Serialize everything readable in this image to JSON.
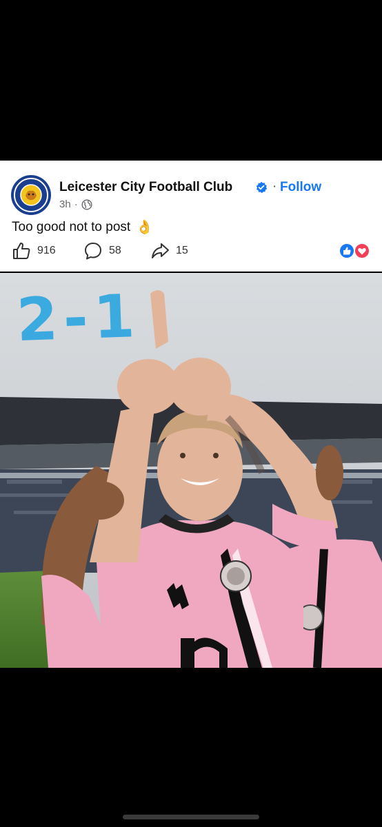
{
  "post": {
    "page_name": "Leicester City Football Club",
    "separator": "·",
    "follow_label": "Follow",
    "time": "3h",
    "meta_separator": "·",
    "caption": "Too good not to post",
    "caption_emoji": "👌",
    "likes": "916",
    "comments": "58",
    "shares": "15"
  },
  "photo": {
    "overlay_text": "2-1"
  },
  "colors": {
    "accent": "#1877f2",
    "overlay": "#2ba5e0",
    "shirt": "#f0a8c0"
  },
  "icons": {
    "avatar": "leicester-crest-icon",
    "verified": "verified-badge-icon",
    "globe": "globe-icon",
    "like": "thumbs-up-icon",
    "comment": "comment-bubble-icon",
    "share": "share-arrow-icon",
    "reactions": "like-love-reactions-icon"
  }
}
